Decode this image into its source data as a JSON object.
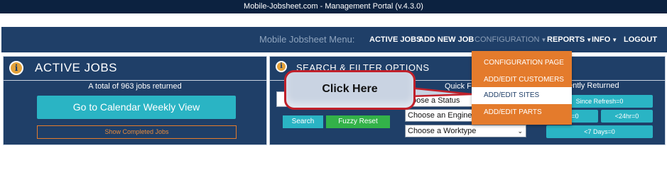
{
  "window": {
    "title": "Mobile-Jobsheet.com - Management Portal  (v.4.3.0)"
  },
  "nav": {
    "menu_title": "Mobile Jobsheet Menu:",
    "items": [
      {
        "label": "ACTIVE JOBS"
      },
      {
        "label": "ADD NEW JOB"
      },
      {
        "label": "CONFIGURATION"
      },
      {
        "label": "REPORTS"
      },
      {
        "label": "INFO"
      },
      {
        "label": "LOGOUT"
      }
    ],
    "caret": "▼"
  },
  "active_jobs": {
    "title": "ACTIVE JOBS",
    "count_text": "A total of 963 jobs returned",
    "calendar_button": "Go to Calendar Weekly View",
    "completed_button": "Show Completed Jobs"
  },
  "search_filter": {
    "title": "SEARCH & FILTER OPTIONS",
    "search_value": "",
    "search_button": "Search",
    "fuzzy_button": "Fuzzy Reset",
    "quick_label": "Quick F",
    "status_select": "hoose a Status",
    "engineer_select": "Choose an Engine",
    "worktype_select": "Choose a Worktype",
    "select_arrow": "⌄"
  },
  "recent": {
    "label": "s Recently Returned",
    "since_refresh": "Since Refresh=0",
    "hr": "hr=0",
    "lt24": "<24hr=0",
    "days7": "<7 Days=0"
  },
  "config_dropdown": {
    "items": [
      {
        "label": "CONFIGURATION PAGE"
      },
      {
        "label": "ADD/EDIT CUSTOMERS"
      },
      {
        "label": "ADD/EDIT SITES"
      },
      {
        "label": "ADD/EDIT PARTS"
      }
    ]
  },
  "callout": {
    "text": "Click Here"
  },
  "icons": {
    "info": "info-icon",
    "caret": "caret-down-icon"
  },
  "colors": {
    "navy": "#1f3f68",
    "topbar": "#0c2240",
    "teal": "#2ab4c4",
    "green": "#33b249",
    "orange": "#e47b2c",
    "callout_border": "#c0202a"
  }
}
